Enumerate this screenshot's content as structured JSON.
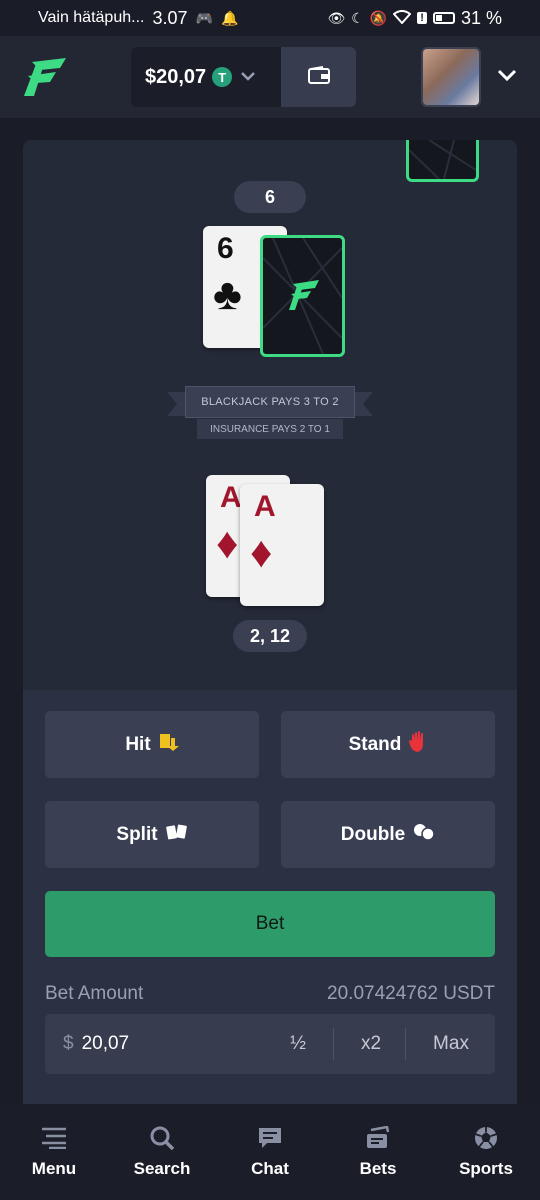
{
  "status": {
    "carrier": "Vain hätäpuh...",
    "time": "3.07",
    "battery": "31 %"
  },
  "header": {
    "balance": "$20,07",
    "currency_symbol": "T",
    "wallet_icon": "wallet-icon"
  },
  "game": {
    "dealer_score": "6",
    "dealer_card_rank": "6",
    "dealer_card_suit": "♣",
    "banner_main": "BLACKJACK PAYS 3 TO 2",
    "banner_sub": "INSURANCE PAYS 2 TO 1",
    "player_cards": [
      {
        "rank": "A",
        "suit": "♦"
      },
      {
        "rank": "A",
        "suit": "♦"
      }
    ],
    "player_score": "2, 12"
  },
  "actions": {
    "hit": "Hit",
    "stand": "Stand",
    "split": "Split",
    "double": "Double",
    "bet": "Bet"
  },
  "bet": {
    "label": "Bet Amount",
    "balance": "20.07424762 USDT",
    "currency": "$",
    "value": "20,07",
    "half": "½",
    "double": "x2",
    "max": "Max"
  },
  "nav": [
    {
      "label": "Menu",
      "icon": "menu-icon"
    },
    {
      "label": "Search",
      "icon": "search-icon"
    },
    {
      "label": "Chat",
      "icon": "chat-icon"
    },
    {
      "label": "Bets",
      "icon": "bets-icon"
    },
    {
      "label": "Sports",
      "icon": "soccer-ball-icon"
    }
  ],
  "colors": {
    "accent": "#3ddc84",
    "bet_button": "#2e9b6a",
    "background": "#1a1d27",
    "panel": "#252a38",
    "card_red": "#a1152d"
  }
}
